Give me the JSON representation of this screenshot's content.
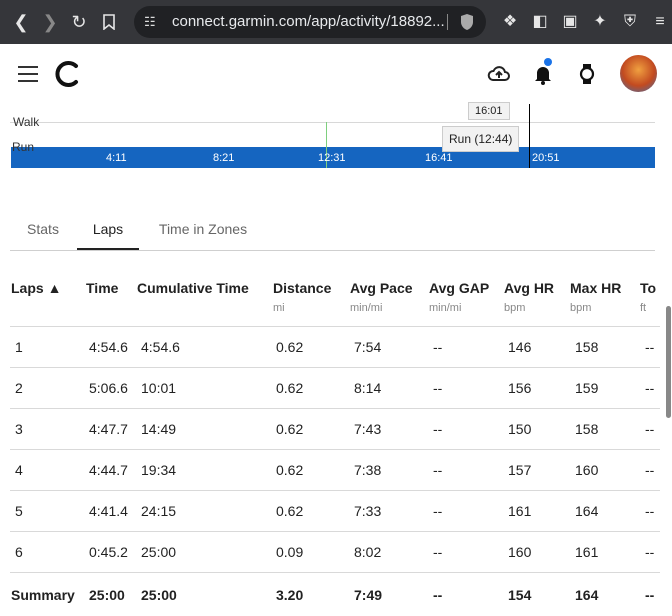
{
  "browser": {
    "url": "connect.garmin.com/app/activity/18892...",
    "back_icon": "back-arrow-icon",
    "forward_icon": "forward-arrow-icon",
    "reload_icon": "reload-icon",
    "bookmark_icon": "bookmark-icon"
  },
  "chart": {
    "labels": {
      "walk": "Walk",
      "run": "Run"
    },
    "ticks": [
      "4:11",
      "8:21",
      "12:31",
      "16:41",
      "20:51"
    ],
    "cursor_time": "16:01",
    "tooltip": "Run (12:44)",
    "run_color": "#1565c0"
  },
  "tabs": [
    {
      "label": "Stats",
      "active": false
    },
    {
      "label": "Laps",
      "active": true
    },
    {
      "label": "Time in Zones",
      "active": false
    }
  ],
  "table": {
    "headers": [
      {
        "label": "Laps ▲",
        "unit": ""
      },
      {
        "label": "Time",
        "unit": ""
      },
      {
        "label": "Cumulative Time",
        "unit": ""
      },
      {
        "label": "Distance",
        "unit": "mi"
      },
      {
        "label": "Avg Pace",
        "unit": "min/mi"
      },
      {
        "label": "Avg GAP",
        "unit": "min/mi"
      },
      {
        "label": "Avg HR",
        "unit": "bpm"
      },
      {
        "label": "Max HR",
        "unit": "bpm"
      },
      {
        "label": "To",
        "unit": "ft"
      }
    ],
    "rows": [
      [
        "1",
        "4:54.6",
        "4:54.6",
        "0.62",
        "7:54",
        "--",
        "146",
        "158",
        "--"
      ],
      [
        "2",
        "5:06.6",
        "10:01",
        "0.62",
        "8:14",
        "--",
        "156",
        "159",
        "--"
      ],
      [
        "3",
        "4:47.7",
        "14:49",
        "0.62",
        "7:43",
        "--",
        "150",
        "158",
        "--"
      ],
      [
        "4",
        "4:44.7",
        "19:34",
        "0.62",
        "7:38",
        "--",
        "157",
        "160",
        "--"
      ],
      [
        "5",
        "4:41.4",
        "24:15",
        "0.62",
        "7:33",
        "--",
        "161",
        "164",
        "--"
      ],
      [
        "6",
        "0:45.2",
        "25:00",
        "0.09",
        "8:02",
        "--",
        "160",
        "161",
        "--"
      ]
    ],
    "summary": [
      "Summary",
      "25:00",
      "25:00",
      "3.20",
      "7:49",
      "--",
      "154",
      "164",
      "--"
    ]
  }
}
